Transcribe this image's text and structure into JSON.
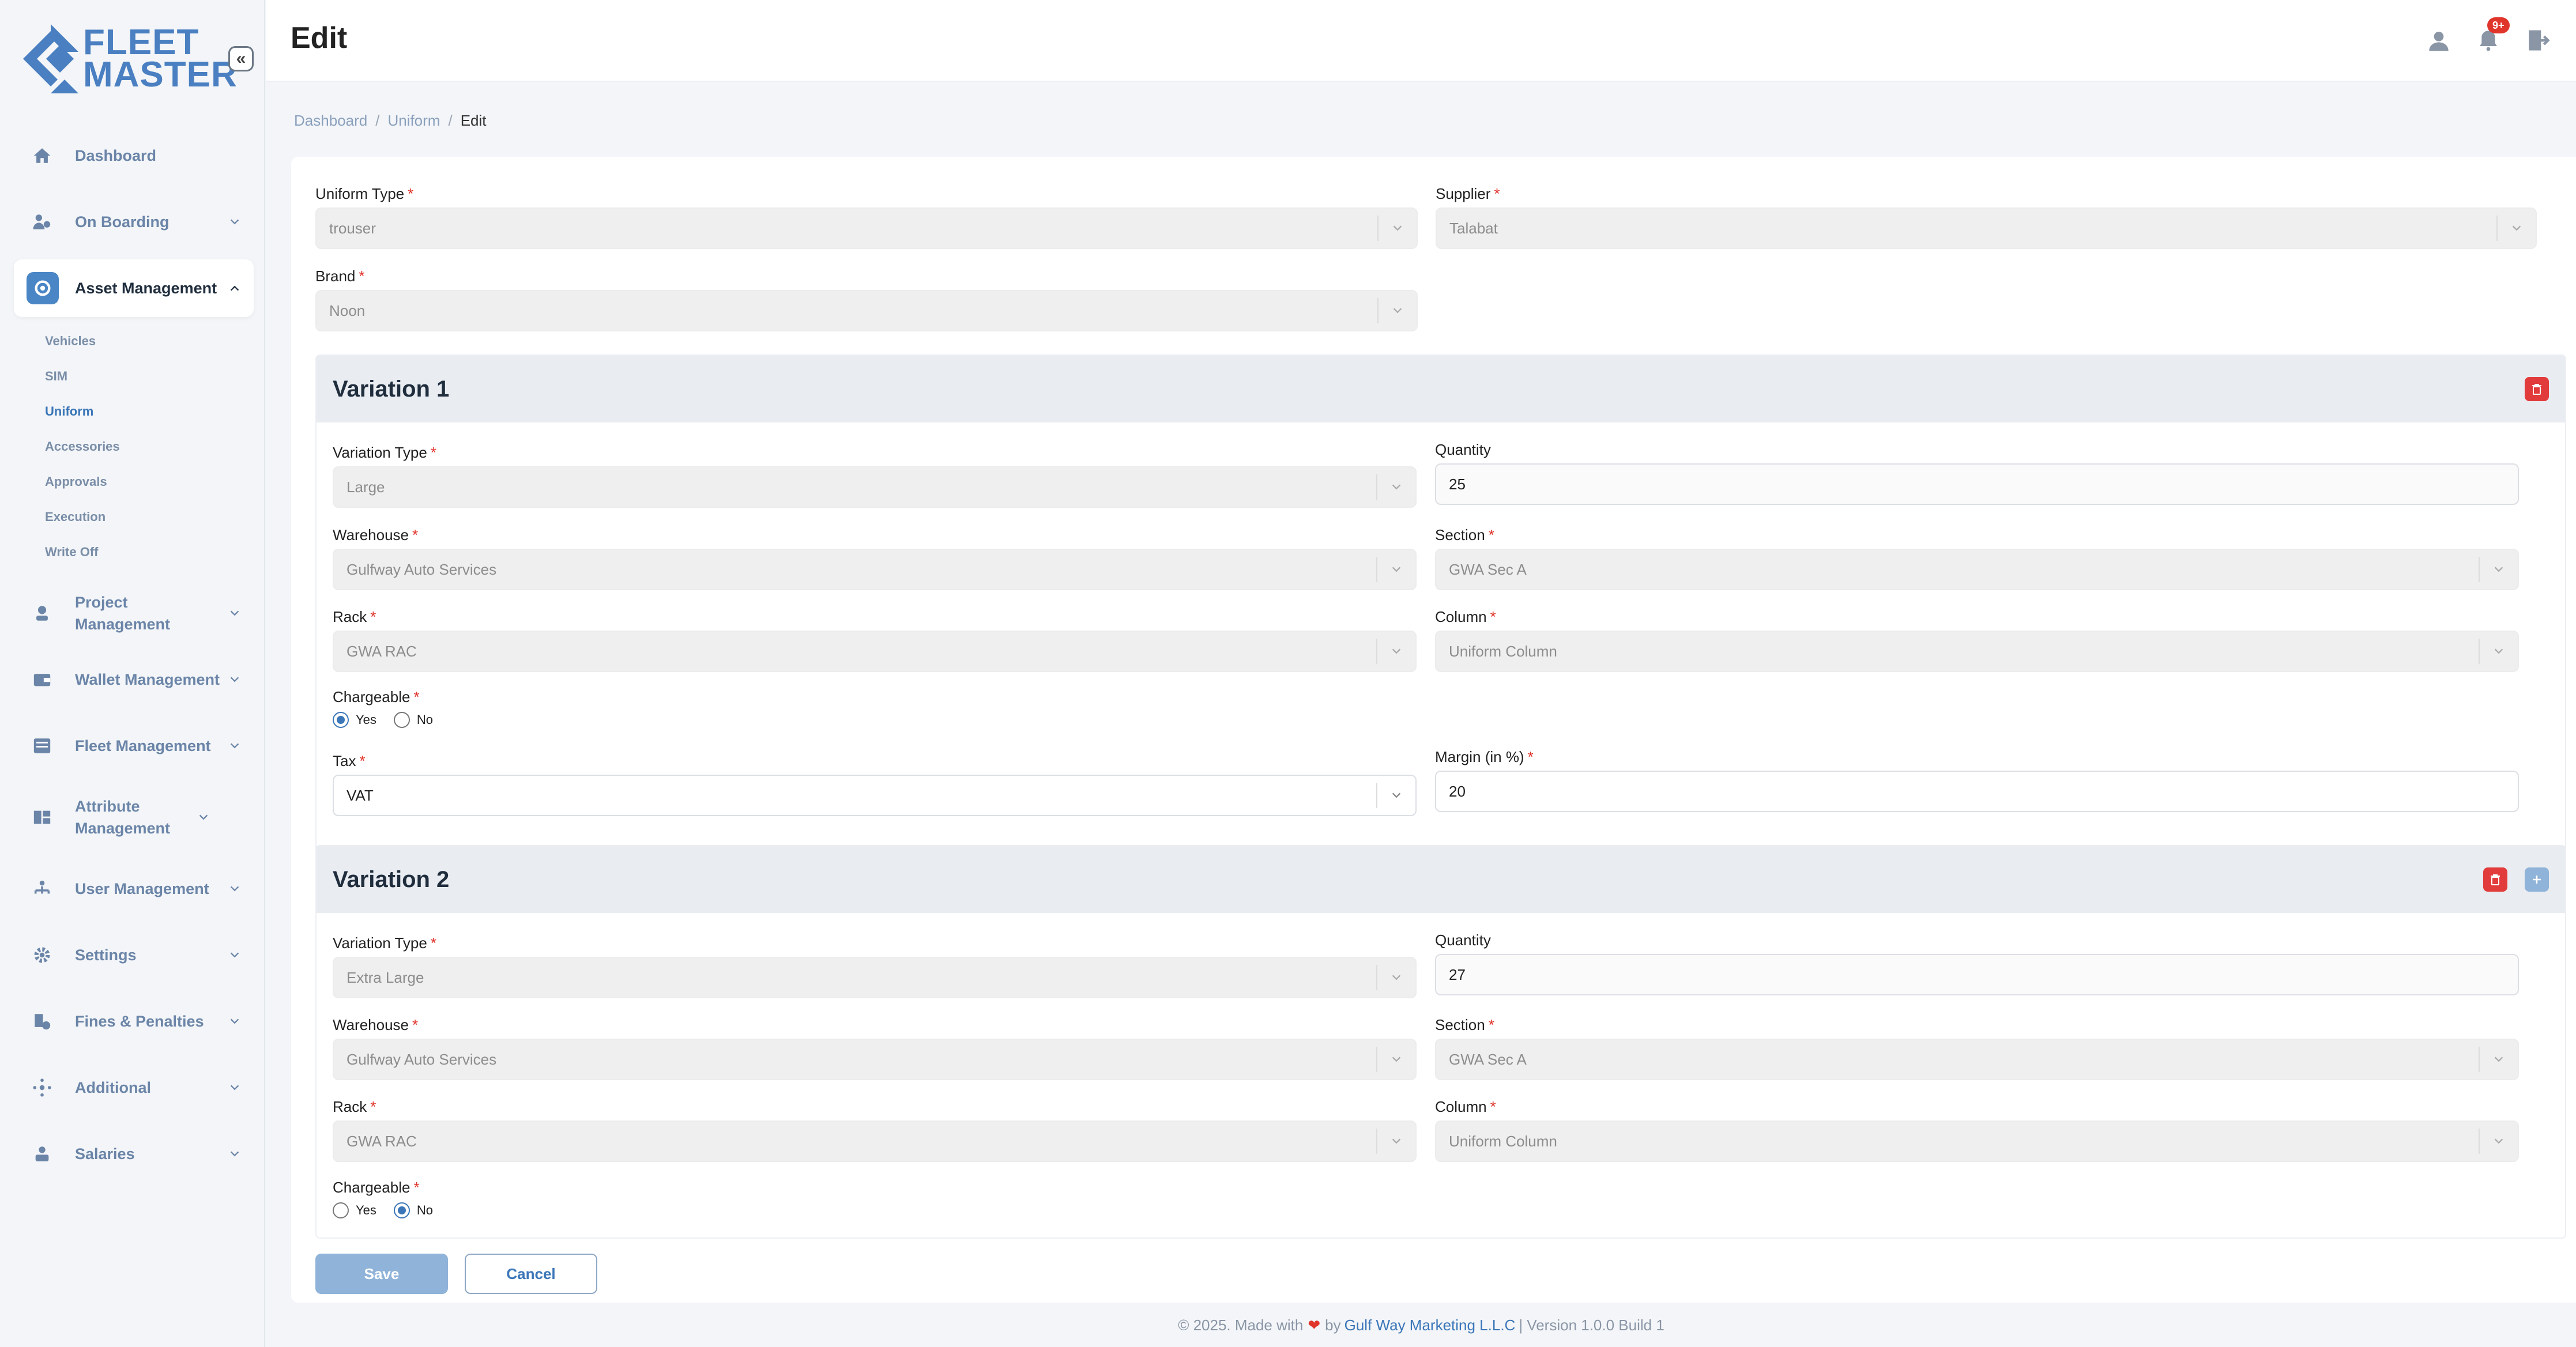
{
  "app": {
    "logo_line1": "FLEET",
    "logo_line2": "MASTER"
  },
  "header": {
    "title": "Edit",
    "notif_badge": "9+"
  },
  "breadcrumb": {
    "items": [
      "Dashboard",
      "Uniform"
    ],
    "current": "Edit"
  },
  "sidebar": {
    "items": [
      {
        "label": "Dashboard",
        "icon": "home-icon"
      },
      {
        "label": "On Boarding",
        "icon": "onboarding-icon"
      },
      {
        "label": "Asset Management",
        "icon": "asset-icon"
      },
      {
        "label": "Project Management",
        "icon": "project-icon"
      },
      {
        "label": "Wallet Management",
        "icon": "wallet-icon"
      },
      {
        "label": "Fleet Management",
        "icon": "fleet-icon"
      },
      {
        "label": "Attribute Management",
        "icon": "attribute-icon"
      },
      {
        "label": "User Management",
        "icon": "user-management-icon"
      },
      {
        "label": "Settings",
        "icon": "gear-icon"
      },
      {
        "label": "Fines & Penalties",
        "icon": "fines-icon"
      },
      {
        "label": "Additional",
        "icon": "additional-icon"
      },
      {
        "label": "Salaries",
        "icon": "salaries-icon"
      }
    ],
    "sub_items": [
      "Vehicles",
      "SIM",
      "Uniform",
      "Accessories",
      "Approvals",
      "Execution",
      "Write Off"
    ]
  },
  "form": {
    "uniform_type": {
      "label": "Uniform Type",
      "value": "trouser"
    },
    "supplier": {
      "label": "Supplier",
      "value": "Talabat"
    },
    "brand": {
      "label": "Brand",
      "value": "Noon"
    },
    "variations": [
      {
        "title": "Variation 1",
        "variation_type": {
          "label": "Variation Type",
          "value": "Large"
        },
        "quantity": {
          "label": "Quantity",
          "value": "25"
        },
        "warehouse": {
          "label": "Warehouse",
          "value": "Gulfway Auto Services"
        },
        "section": {
          "label": "Section",
          "value": "GWA Sec A"
        },
        "rack": {
          "label": "Rack",
          "value": "GWA RAC"
        },
        "column": {
          "label": "Column",
          "value": "Uniform Column"
        },
        "chargeable": {
          "label": "Chargeable",
          "yes": "Yes",
          "no": "No",
          "selected": "Yes"
        },
        "tax": {
          "label": "Tax",
          "value": "VAT"
        },
        "margin": {
          "label": "Margin (in %)",
          "value": "20"
        }
      },
      {
        "title": "Variation 2",
        "variation_type": {
          "label": "Variation Type",
          "value": "Extra Large"
        },
        "quantity": {
          "label": "Quantity",
          "value": "27"
        },
        "warehouse": {
          "label": "Warehouse",
          "value": "Gulfway Auto Services"
        },
        "section": {
          "label": "Section",
          "value": "GWA Sec A"
        },
        "rack": {
          "label": "Rack",
          "value": "GWA RAC"
        },
        "column": {
          "label": "Column",
          "value": "Uniform Column"
        },
        "chargeable": {
          "label": "Chargeable",
          "yes": "Yes",
          "no": "No",
          "selected": "No"
        }
      }
    ],
    "save_label": "Save",
    "cancel_label": "Cancel"
  },
  "footer": {
    "prefix": "© 2025. Made with",
    "by": "by",
    "company": "Gulf Way Marketing L.L.C",
    "version": "| Version 1.0.0 Build 1"
  },
  "colors": {
    "accent": "#3b76b8",
    "danger": "#e23b3b",
    "sidebar_bg": "#f3f5f8"
  }
}
